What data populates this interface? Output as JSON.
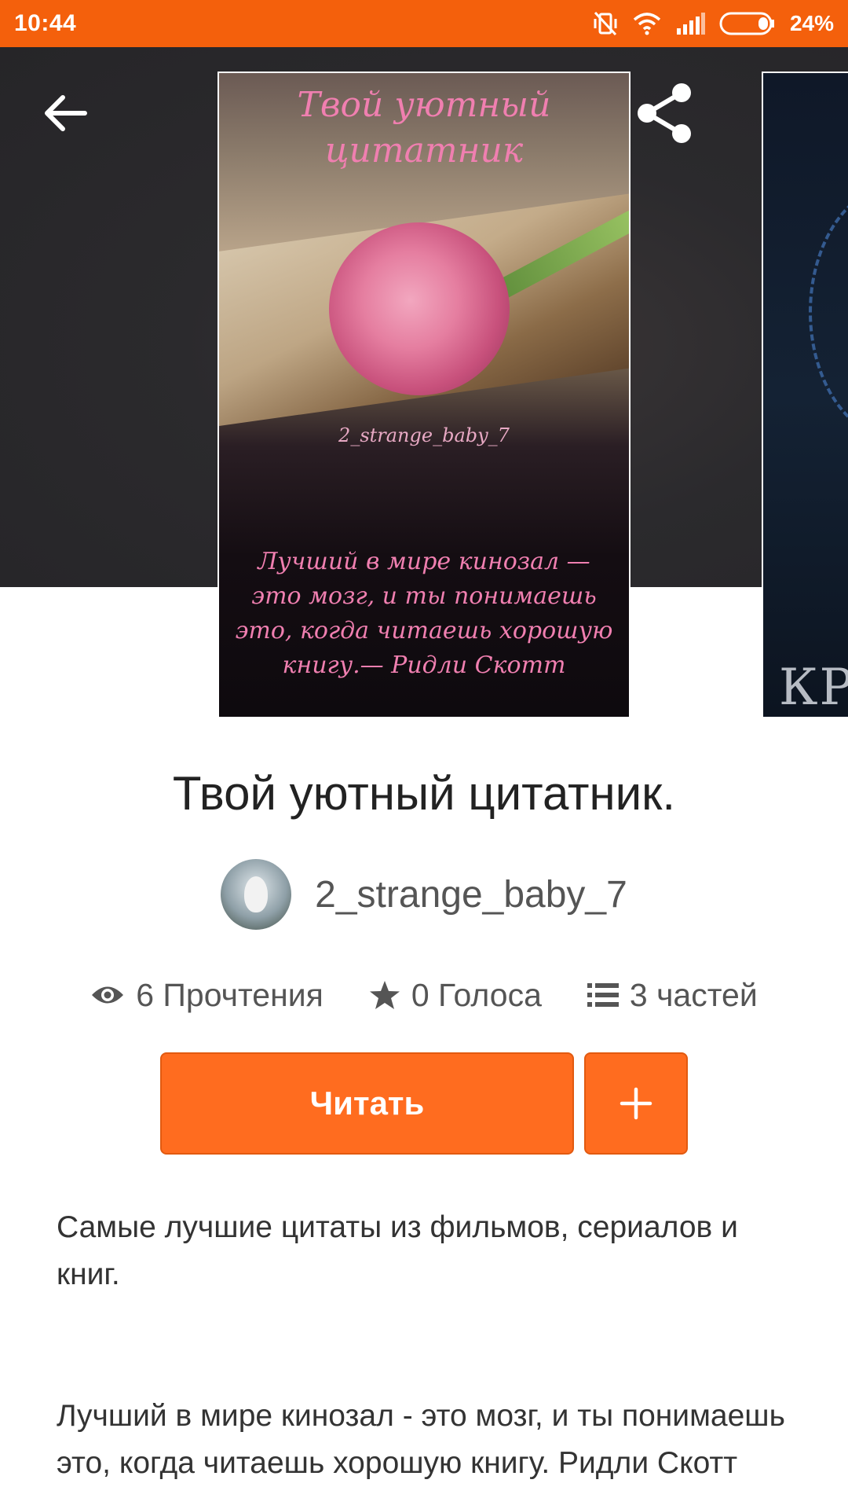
{
  "status_bar": {
    "time": "10:44",
    "battery": "24%",
    "icons": [
      "mute-vibrate-icon",
      "wifi-icon",
      "signal-icon",
      "battery-icon"
    ]
  },
  "toolbar": {
    "icons": [
      "back-arrow-icon",
      "share-icon",
      "more-vert-icon"
    ]
  },
  "cover": {
    "title": "Твой уютный цитатник",
    "author": "2_strange_baby_7",
    "quote": "Лучший в мире кинозал — это мозг, и ты понимаешь это, когда читаешь хорошую книгу.— Ридли Скотт",
    "next_cover_text": "КРИ"
  },
  "story": {
    "title": "Твой уютный цитатник.",
    "author": "2_strange_baby_7"
  },
  "stats": {
    "reads": "6 Прочтения",
    "votes": "0 Голоса",
    "parts": "3 частей"
  },
  "actions": {
    "read_label": "Читать",
    "add_label": "+"
  },
  "description": {
    "p1": "Самые лучшие цитаты из фильмов, сериалов и книг.",
    "p2": "Лучший в мире кинозал - это мозг, и ты понимаешь это, когда читаешь хорошую книгу. Ридли Скотт"
  },
  "colors": {
    "accent": "#ff6c1f",
    "status_bar": "#f4600c",
    "hero_bg": "#2b2a2d"
  }
}
